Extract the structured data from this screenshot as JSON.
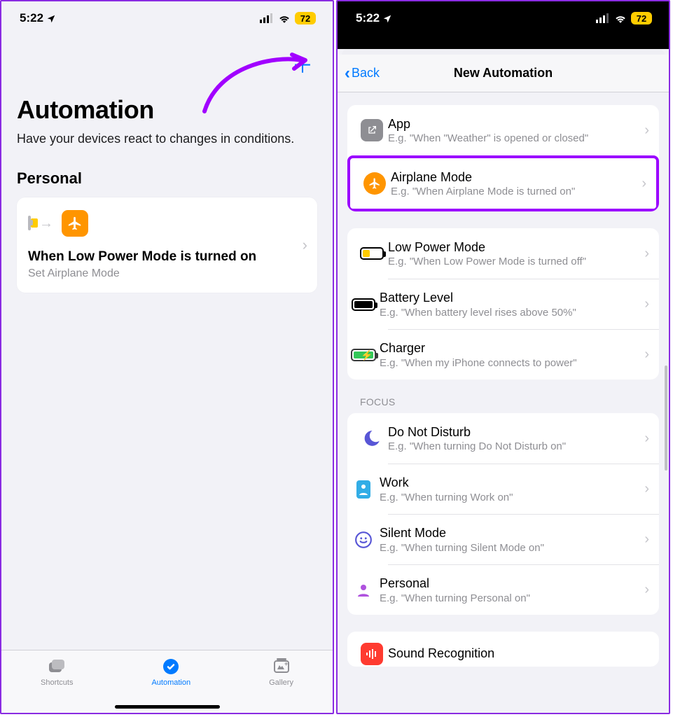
{
  "status": {
    "time": "5:22",
    "battery": "72"
  },
  "left": {
    "title": "Automation",
    "subtitle": "Have your devices react to changes in conditions.",
    "section": "Personal",
    "card": {
      "title": "When Low Power Mode is turned on",
      "subtitle": "Set Airplane Mode"
    },
    "tabs": {
      "shortcuts": "Shortcuts",
      "automation": "Automation",
      "gallery": "Gallery"
    }
  },
  "right": {
    "back": "Back",
    "title": "New Automation",
    "groups": [
      {
        "rows": [
          {
            "title": "App",
            "sub": "E.g. \"When \"Weather\" is opened or closed\""
          },
          {
            "title": "Airplane Mode",
            "sub": "E.g. \"When Airplane Mode is turned on\""
          }
        ]
      },
      {
        "rows": [
          {
            "title": "Low Power Mode",
            "sub": "E.g. \"When Low Power Mode is turned off\""
          },
          {
            "title": "Battery Level",
            "sub": "E.g. \"When battery level rises above 50%\""
          },
          {
            "title": "Charger",
            "sub": "E.g. \"When my iPhone connects to power\""
          }
        ]
      },
      {
        "header": "FOCUS",
        "rows": [
          {
            "title": "Do Not Disturb",
            "sub": "E.g. \"When turning Do Not Disturb on\""
          },
          {
            "title": "Work",
            "sub": "E.g. \"When turning Work on\""
          },
          {
            "title": "Silent Mode",
            "sub": "E.g. \"When turning Silent Mode  on\""
          },
          {
            "title": "Personal",
            "sub": "E.g. \"When turning Personal on\""
          }
        ]
      },
      {
        "rows": [
          {
            "title": "Sound Recognition",
            "sub": ""
          }
        ]
      }
    ]
  }
}
